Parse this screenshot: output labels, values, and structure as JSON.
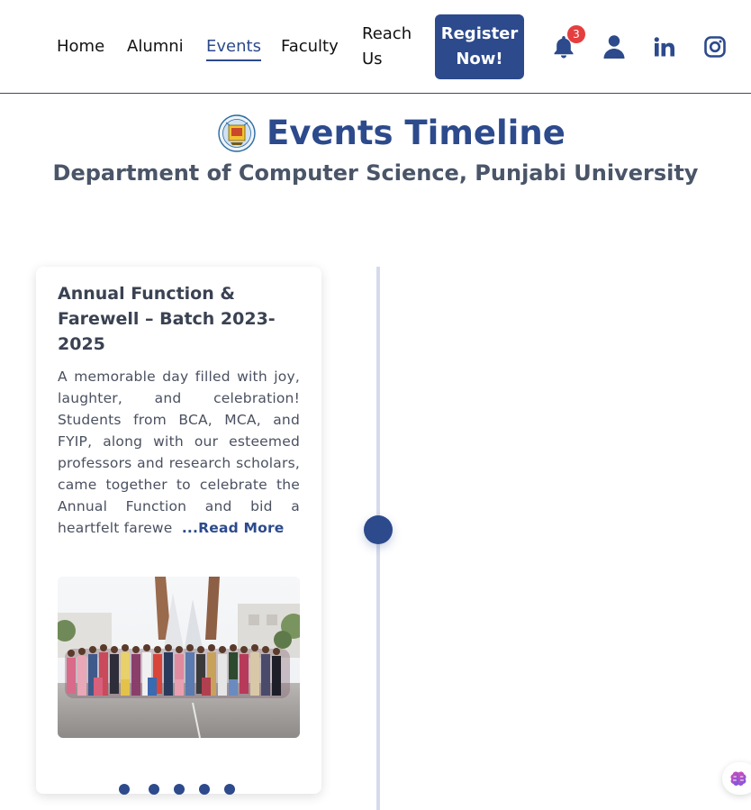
{
  "nav": {
    "home": "Home",
    "alumni": "Alumni",
    "events": "Events",
    "faculty": "Faculty",
    "reach_us": "Reach Us",
    "register": "Register Now!"
  },
  "notifications": {
    "count": "3",
    "icon": "bell-icon"
  },
  "icons": [
    "bell-icon",
    "user-icon",
    "linkedin-icon",
    "instagram-icon",
    "brain-icon"
  ],
  "colors": {
    "brand": "#2c4a8c",
    "badge": "#e53e3e",
    "timeline": "#d5dbea"
  },
  "hero": {
    "title": "Events Timeline",
    "subtitle": "Department of Computer Science, Punjabi University"
  },
  "event": {
    "title": "Annual Function & Farewell – Batch 2023-2025",
    "description": "A memorable day filled with joy, laughter, and celebration! Students from BCA, MCA, and FYIP, along with our esteemed professors and research scholars, came together to celebrate the Annual Function and bid a heartfelt farewe",
    "read_more": "...Read More",
    "slide_count": 5
  }
}
